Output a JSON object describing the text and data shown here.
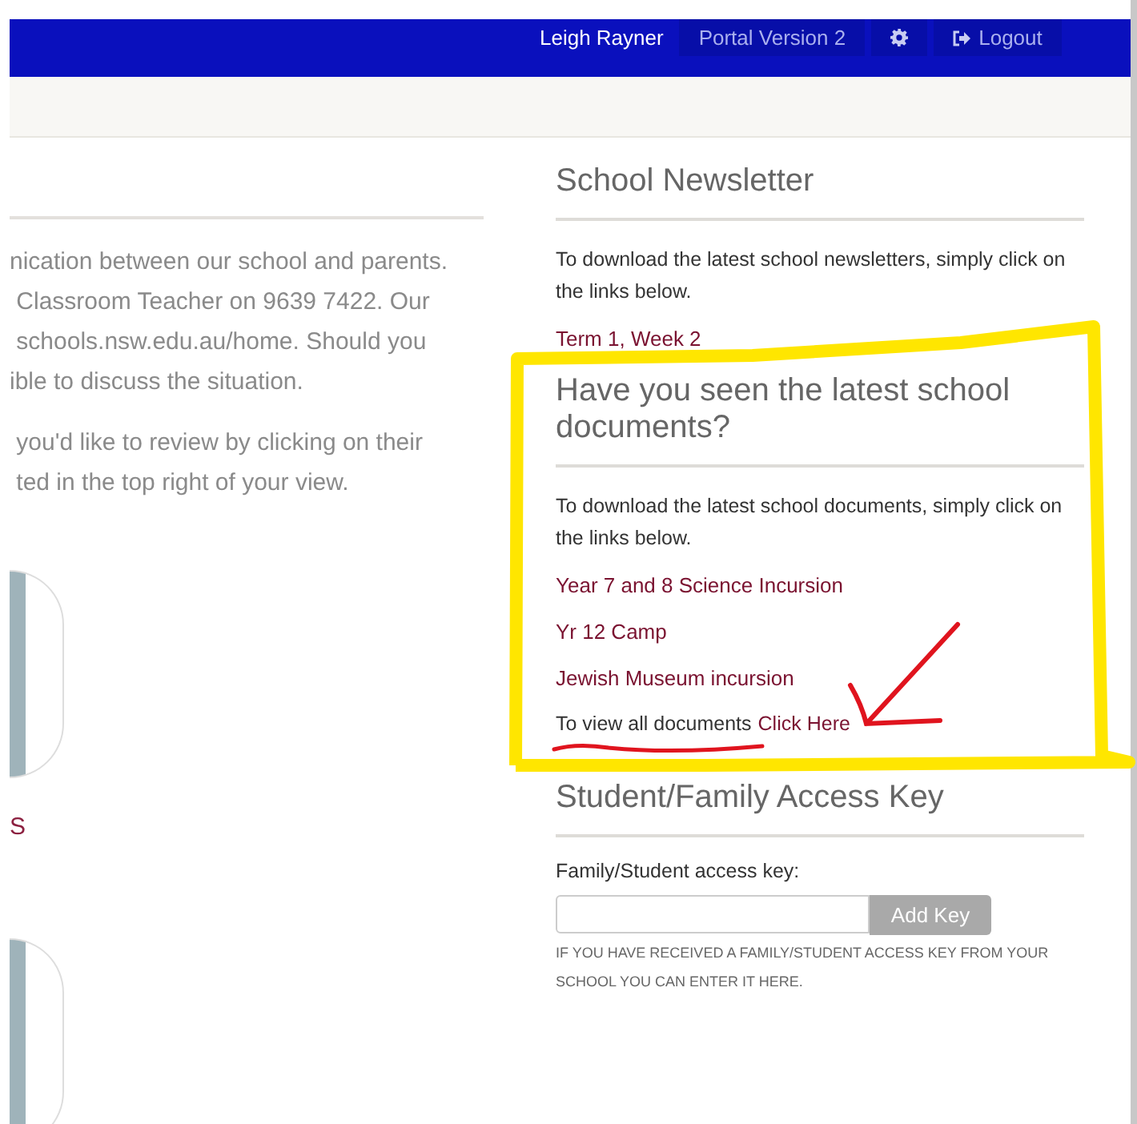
{
  "header": {
    "user_name": "Leigh Rayner",
    "buttons": [
      {
        "kind": "text",
        "label": "Portal Version 2"
      },
      {
        "kind": "settings"
      },
      {
        "kind": "logout",
        "label": "Logout"
      }
    ]
  },
  "intro": {
    "paragraphs": [
      [
        "nication between our school and parents.",
        " Classroom Teacher on 9639 7422. Our",
        " schools.nsw.edu.au/home. Should you",
        "ible to discuss the situation."
      ],
      [
        " you'd like to review by clicking on their",
        " ted in the top right of your view."
      ]
    ]
  },
  "students": [
    {
      "name": "S",
      "photo": true
    },
    {
      "photo": true
    }
  ],
  "newsletter": {
    "title": "School Newsletter",
    "text": "To download the latest school newsletters, simply click on the links below.",
    "links": [
      "Term 1, Week 2"
    ]
  },
  "documents": {
    "title": "Have you seen the latest school documents?",
    "text": "To download the latest school documents, simply click on the links below.",
    "links": [
      "Year 7 and 8 Science Incursion",
      "Yr 12 Camp",
      "Jewish Museum incursion"
    ],
    "view_all_text": "To view all documents",
    "view_all_link": "Click Here"
  },
  "access_key": {
    "title": "Student/Family Access Key",
    "label": "Family/Student access key:",
    "button": "Add Key",
    "help": "IF YOU HAVE RECEIVED A FAMILY/STUDENT ACCESS KEY FROM YOUR SCHOOL YOU CAN ENTER IT HERE."
  },
  "annotations": [
    {
      "kind": "highlight-box"
    },
    {
      "kind": "arrow"
    },
    {
      "kind": "underline"
    }
  ]
}
